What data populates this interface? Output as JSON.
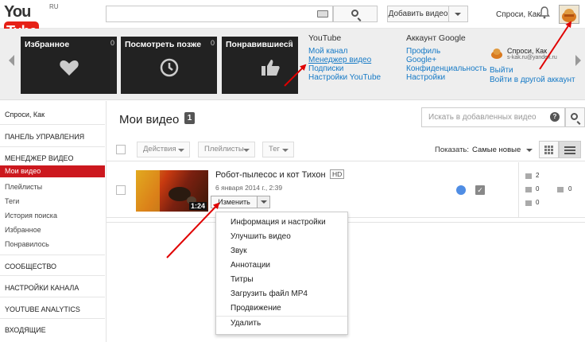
{
  "header": {
    "logo_you": "You",
    "logo_tube": "Tube",
    "logo_region": "RU",
    "search_placeholder": "",
    "upload_label": "Добавить видео",
    "user_name": "Спроси, Как"
  },
  "guide": {
    "tiles": [
      {
        "title": "Избранное",
        "count": "0",
        "icon": "heart-icon"
      },
      {
        "title": "Посмотреть позже",
        "count": "0",
        "icon": "clock-icon"
      },
      {
        "title": "Понравившиеся",
        "count": "0",
        "icon": "thumb-up-icon"
      }
    ],
    "youtube": {
      "heading": "YouTube",
      "links": [
        "Мой канал",
        "Менеджер видео",
        "Подписки",
        "Настройки YouTube"
      ]
    },
    "google": {
      "heading": "Аккаунт Google",
      "links": [
        "Профиль",
        "Google+",
        "Конфиденциальность",
        "Настройки"
      ]
    },
    "account": {
      "name": "Спроси, Как",
      "email": "s-kak.ru@yandex.ru",
      "links": [
        "Выйти",
        "Войти в другой аккаунт"
      ]
    }
  },
  "nav": {
    "user": "Спроси, Как",
    "dashboard": "ПАНЕЛЬ УПРАВЛЕНИЯ",
    "video_manager": "МЕНЕДЖЕР ВИДЕО",
    "items": [
      "Мои видео",
      "Плейлисты",
      "Теги",
      "История поиска",
      "Избранное",
      "Понравилось"
    ],
    "community": "СООБЩЕСТВО",
    "channel_settings": "НАСТРОЙКИ КАНАЛА",
    "analytics": "YOUTUBE ANALYTICS",
    "inbox": "ВХОДЯЩИЕ"
  },
  "main": {
    "title": "Мои видео",
    "count": "1",
    "search_placeholder": "Искать в добавленных видео",
    "help": "?",
    "actions": "Действия",
    "playlists": "Плейлисты",
    "tags": "Тег",
    "show_label": "Показать:",
    "sort_value": "Самые новые"
  },
  "video": {
    "title": "Робот-пылесос и кот Тихон",
    "badge": "HD",
    "date": "6 января 2014 г., 2:39",
    "duration": "1:24",
    "edit_label": "Изменить",
    "stats": {
      "views": "2",
      "likes": "0",
      "dislikes": "0",
      "comments": "0"
    }
  },
  "edit_menu": {
    "items": [
      "Информация и настройки",
      "Улучшить видео",
      "Звук",
      "Аннотации",
      "Титры",
      "Загрузить файл MP4",
      "Продвижение"
    ],
    "delete": "Удалить"
  },
  "colors": {
    "brand_red": "#e62117",
    "link_blue": "#167ac6",
    "annotation_red": "#e00000"
  }
}
